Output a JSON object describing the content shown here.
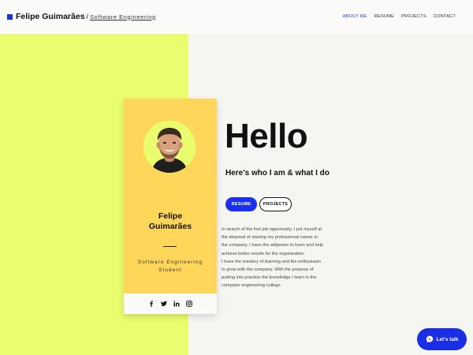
{
  "header": {
    "name": "Felipe Guimarães",
    "slash": "/",
    "role": "Software Engineering",
    "nav": [
      "ABOUT ME",
      "RESUME",
      "PROJECTS",
      "CONTACT"
    ],
    "active_nav": "ABOUT ME"
  },
  "card": {
    "name_line1": "Felipe",
    "name_line2": "Guimarães",
    "role_line1": "Software Engineering",
    "role_line2": "Student",
    "socials": [
      "facebook-icon",
      "twitter-icon",
      "linkedin-icon",
      "instagram-icon"
    ]
  },
  "main": {
    "greeting": "Hello",
    "subtitle": "Here's who I am & what I do",
    "buttons": {
      "resume": "RESUME",
      "projects": "PROJECTS"
    },
    "bio": [
      "In search of the first job opportunity, I put myself at the disposal of starting my professional career in the company. I have the willpower to learn and help achieve better results for the organization.",
      "I have the mastery of learning and the enthusiasm to grow with the company. With the purpose of putting into practice the knowledge I learn in the computer engineering college."
    ]
  },
  "chat": {
    "label": "Let's talk"
  },
  "colors": {
    "accent": "#1a30f0",
    "lime": "#e9fd6e",
    "card": "#fdd65a"
  }
}
